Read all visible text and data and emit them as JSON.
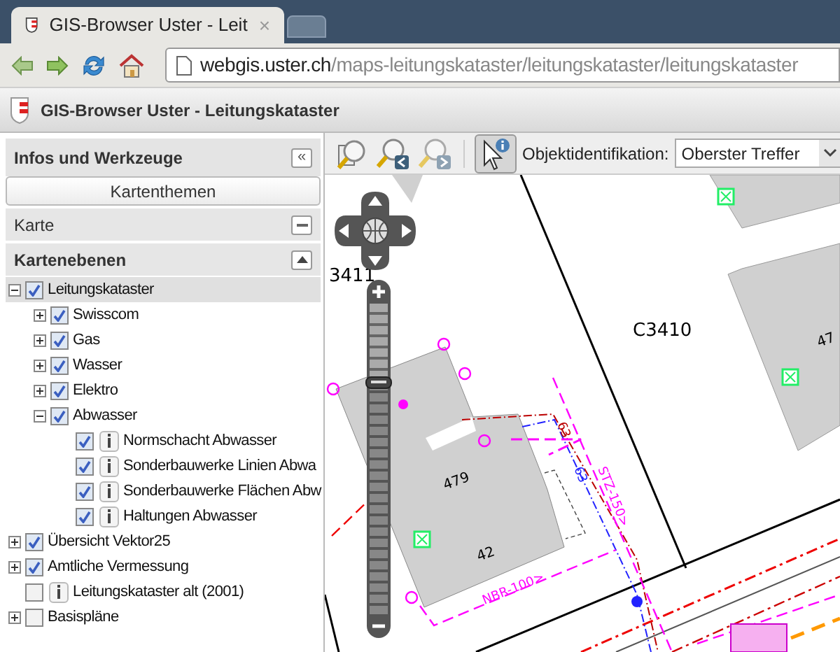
{
  "browser": {
    "tabs": [
      {
        "title": "GIS-Browser Uster - Leit",
        "selected": true
      },
      {
        "selected": false
      }
    ],
    "close_glyph": "×",
    "url_host": "webgis.uster.ch",
    "url_path": "/maps-leitungskataster/leitungskataster/leitungskataster"
  },
  "app": {
    "title": "GIS-Browser Uster - Leitungskataster"
  },
  "sidebar": {
    "title": "Infos und Werkzeuge",
    "collapse_glyph": "«",
    "themes_button": "Kartenthemen",
    "sections": [
      {
        "title": "Karte",
        "bold": false,
        "expanded": false
      },
      {
        "title": "Kartenebenen",
        "bold": true,
        "expanded": true
      }
    ],
    "tree": [
      {
        "label": "Leitungskataster",
        "checked": true,
        "expanded": true,
        "selected": true,
        "children": [
          {
            "label": "Swisscom",
            "checked": true,
            "expanded": false
          },
          {
            "label": "Gas",
            "checked": true,
            "expanded": false
          },
          {
            "label": "Wasser",
            "checked": true,
            "expanded": false
          },
          {
            "label": "Elektro",
            "checked": true,
            "expanded": false
          },
          {
            "label": "Abwasser",
            "checked": true,
            "expanded": true,
            "children": [
              {
                "label": "Normschacht Abwasser",
                "checked": true,
                "info": true
              },
              {
                "label": "Sonderbauwerke Linien Abwa",
                "checked": true,
                "info": true
              },
              {
                "label": "Sonderbauwerke Flächen Abw",
                "checked": true,
                "info": true
              },
              {
                "label": "Haltungen Abwasser",
                "checked": true,
                "info": true
              }
            ]
          }
        ]
      },
      {
        "label": "Übersicht Vektor25",
        "checked": true,
        "expanded": false
      },
      {
        "label": "Amtliche Vermessung",
        "checked": true,
        "expanded": false
      },
      {
        "label": "Leitungskataster alt (2001)",
        "checked": false,
        "info": true
      },
      {
        "label": "Basispläne",
        "checked": false,
        "expanded": false
      }
    ]
  },
  "toolbar": {
    "identify_active": true,
    "identify_label": "Objektidentifikation:",
    "identify_value": "Oberster Treffer"
  },
  "map": {
    "labels": [
      {
        "text": "3411",
        "kind": "parcel"
      },
      {
        "text": "C3410",
        "kind": "parcel"
      },
      {
        "text": "479",
        "kind": "building"
      },
      {
        "text": "42",
        "kind": "building"
      },
      {
        "text": "47",
        "kind": "building"
      },
      {
        "text": "63",
        "kind": "line"
      },
      {
        "text": "63",
        "kind": "line"
      },
      {
        "text": "STZ-150>",
        "kind": "line"
      },
      {
        "text": "NBR-100>",
        "kind": "line"
      }
    ],
    "zoom": {
      "level": 0.75
    }
  }
}
